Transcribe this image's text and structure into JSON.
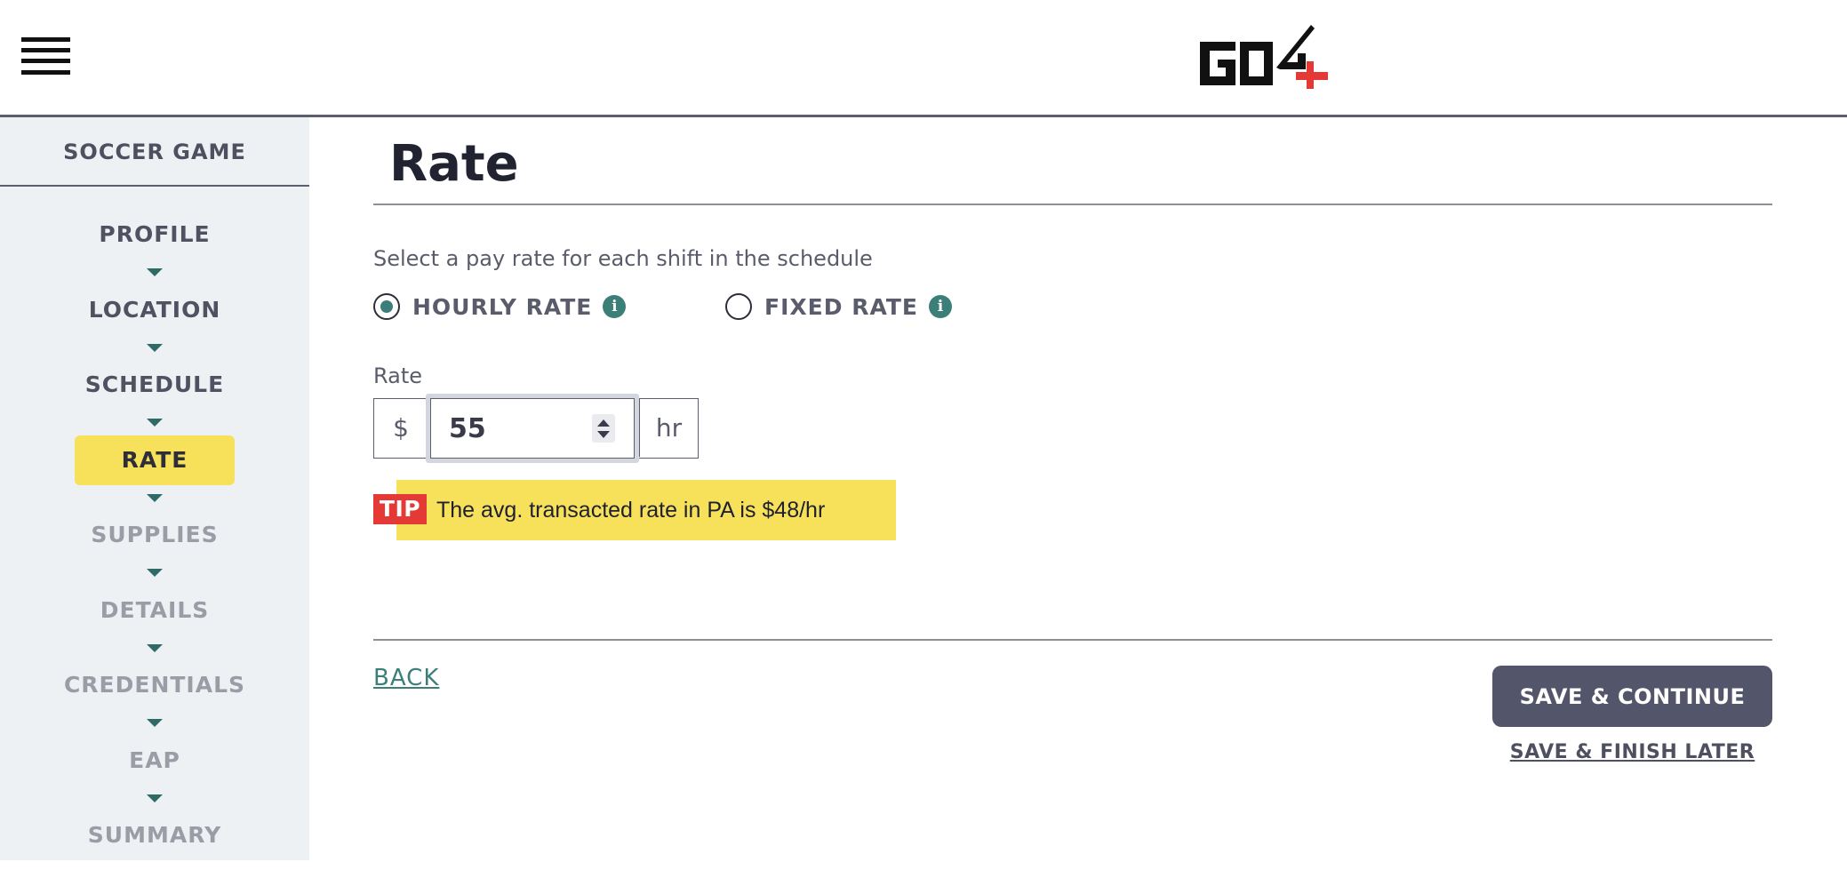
{
  "header": {
    "menu_icon": "hamburger-menu-icon",
    "logo_text": "GO4",
    "logo_colors": {
      "primary": "#111111",
      "accent": "#e53935"
    }
  },
  "sidebar": {
    "title": "SOCCER GAME",
    "steps": [
      {
        "label": "PROFILE",
        "state": "completed"
      },
      {
        "label": "LOCATION",
        "state": "completed"
      },
      {
        "label": "SCHEDULE",
        "state": "completed"
      },
      {
        "label": "RATE",
        "state": "active"
      },
      {
        "label": "SUPPLIES",
        "state": "upcoming"
      },
      {
        "label": "DETAILS",
        "state": "upcoming"
      },
      {
        "label": "CREDENTIALS",
        "state": "upcoming"
      },
      {
        "label": "EAP",
        "state": "upcoming"
      },
      {
        "label": "SUMMARY",
        "state": "upcoming"
      }
    ]
  },
  "main": {
    "title": "Rate",
    "instruction": "Select a pay rate for each shift in the schedule",
    "rate_types": [
      {
        "label": "HOURLY RATE",
        "selected": true,
        "info_icon": "info-icon"
      },
      {
        "label": "FIXED RATE",
        "selected": false,
        "info_icon": "info-icon"
      }
    ],
    "rate_field": {
      "label": "Rate",
      "currency": "$",
      "value": "55",
      "unit": "hr"
    },
    "tip": {
      "badge": "TIP",
      "text": "The avg. transacted rate in PA is $48/hr"
    },
    "actions": {
      "back": "BACK",
      "save_continue": "SAVE & CONTINUE",
      "save_later": "SAVE & FINISH LATER"
    }
  },
  "colors": {
    "accent_teal": "#3c7f79",
    "highlight_yellow": "#f7e05a",
    "tip_red": "#e53935",
    "button_dark": "#53566a",
    "sidebar_bg": "#eef1f4"
  }
}
